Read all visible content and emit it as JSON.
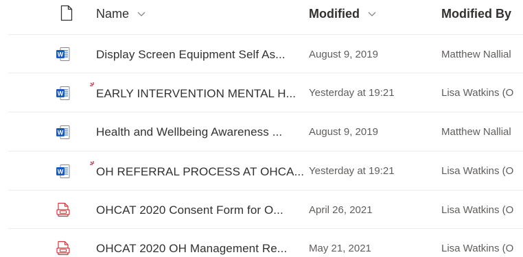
{
  "columns": {
    "name": "Name",
    "modified": "Modified",
    "modified_by": "Modified By"
  },
  "files": [
    {
      "name": "Display Screen Equipment  Self As...",
      "modified": "August 9, 2019",
      "modified_by": "Matthew Nallial",
      "type": "word",
      "is_new": false
    },
    {
      "name": "EARLY INTERVENTION MENTAL H...",
      "modified": "Yesterday at 19:21",
      "modified_by": "Lisa Watkins (O",
      "type": "word",
      "is_new": true
    },
    {
      "name": "Health and Wellbeing Awareness ...",
      "modified": "August 9, 2019",
      "modified_by": "Matthew Nallial",
      "type": "word",
      "is_new": false
    },
    {
      "name": "OH REFERRAL PROCESS AT OHCA...",
      "modified": "Yesterday at 19:21",
      "modified_by": "Lisa Watkins (O",
      "type": "word",
      "is_new": true
    },
    {
      "name": "OHCAT 2020 Consent Form for O...",
      "modified": "April 26, 2021",
      "modified_by": "Lisa Watkins (O",
      "type": "pdf",
      "is_new": false
    },
    {
      "name": "OHCAT 2020 OH Management Re...",
      "modified": "May 21, 2021",
      "modified_by": "Lisa Watkins (O",
      "type": "pdf",
      "is_new": false
    }
  ],
  "colors": {
    "word_blue": "#185abd",
    "pdf_red": "#d13438",
    "new_mark": "#c4314b"
  }
}
